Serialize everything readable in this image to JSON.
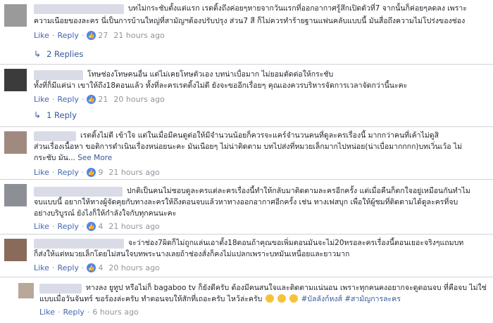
{
  "comments": [
    {
      "lines": [
        "บทไม่กระชับตั้งแต่แรก เรตติ้งถึงค่อยๆหายจากวันแรกที่ออกอากาศรู้สึกเปิดตัวที่7  จากนั้นก็ค่อยๆลดลง เพราะ",
        "ความเนือยของละคร นี่เป็นการบ้านใหญ่ที่สามัญฯต้องปรับปรุง ส่วน7 สี ก็ไม่ควรทำร้ายฐานแฟนคลับแบบนี้ มันสื่อถึงความไม่โปร่งของช่อง"
      ],
      "like_label": "Like",
      "reply_label": "Reply",
      "like_count": "27",
      "time": "21 hours ago",
      "replies_label": "2 Replies"
    },
    {
      "lines": [
        "โทษช่องโทษคนอื่น แต่ไม่เคยโทษตัวเอง บทน่าเบื่อมาก ไม่ยอมตัดต่อให้กระชับ",
        "ทั้งที่ก็มีแค่น่า เขาให้ถึง18ตอนแล้ว ทั้งที่ละครเรตติ้งไม่ดี ยังจะขออีกเรื่อยๆ คุณเองควรบริหารจัดการเวลาจัดกว่านี้นะคะ"
      ],
      "like_label": "Like",
      "reply_label": "Reply",
      "like_count": "21",
      "time": "20 hours ago",
      "replies_label": "1 Reply"
    },
    {
      "lines": [
        "เรตติ้งไม่ดี เข้าใจ แต่ในเมื่อมีคนดูต่อให้มีจำนวนน้อยก็ควรจะแคร์จำนวนคนที่ดูละครเรื่องนี้ มากกว่าคนที่เค้าไม่ดูสิ",
        "ส่วนเรื่องเนื้อหา ขอติการดำเนินเรื่องหน่อยนะคะ มันเนือยๆ ไม่น่าติดตาม บทไปส่งที่หมวยเล็กมากไปหน่อย(น่าเบื่อมากกกก)บทเวิ่นเว้อ ไม่",
        "กระชับ มัน..."
      ],
      "see_more": "See More",
      "like_label": "Like",
      "reply_label": "Reply",
      "like_count": "9",
      "time": "21 hours ago"
    },
    {
      "lines": [
        "ปกติเป็นคนไม่ชอบดูละครแต่ละครเรื่องนี้ทำให้กลับมาติดตามละครอีกครั้ง แต่เมื่อคืนก็ตกใจอยู่เหมือนกันทำไม",
        "จบแบบนี้ อยากให้ทางผู้จัดคุยกับทางละครให้ถึงตอนจบแล้วหาทางออกอากาศอีกครั้ง เช่น ทางเฟสบุก เพื่อให้ผู้ชมที่ติดตามได้ดูละครที่จบ",
        "อย่างบริบูรณ์ ยังไงก็ให้กำลังใจกับทุกคนนะคะ"
      ],
      "like_label": "Like",
      "reply_label": "Reply",
      "like_count": "4",
      "time": "21 hours ago"
    },
    {
      "lines": [
        "จะว่าช่อง7ผิดก็ไม่ถูกแล่นเอาตั้ง18ตอนถ้าคุณขอเพิ่มตอนมันจะไม่20หรอละครเรื่องนี้ตอนเยอะจริงๆแถมบท",
        "ก็ส่งให้แต่หมวยเล็กโดยไม่สนใจบทพระนางเลยถ้าช่องสั่งก็คงไม่แปลกเพราะบทมันเหนื่อยและยาวมาก"
      ],
      "like_label": "Like",
      "reply_label": "Reply",
      "like_count": "4",
      "time": "20 hours ago"
    },
    {
      "lines_main": [
        "ทางลง ยูทูป หรือไม่ก็ bagaboo tv ก็ยังดีครับ ต้องมีคนสนใจและติดตามแน่นอน เพราะทุกคนคงอยากจะดูตอนจบ ที่คือจบ ไม่ใช่",
        "แบบเมื่อวันจันทร์ ขอร้องล่ะครับ ทำตอนจบให้สักที่เถอะครับ ไหว้ล่ะครับ"
      ],
      "hashtags": "#บัลลังก์หงส์ #สามัญการละคร",
      "like_label": "Like",
      "reply_label": "Reply",
      "time": "6 hours ago"
    }
  ],
  "icons": {
    "like": "thumbs-up-icon",
    "reply_arrow": "reply-arrow-icon",
    "emoji": "sad-face-emoji"
  },
  "colors": {
    "link": "#4267b2",
    "meta": "#90949c",
    "like_badge": "#4f83ee"
  }
}
